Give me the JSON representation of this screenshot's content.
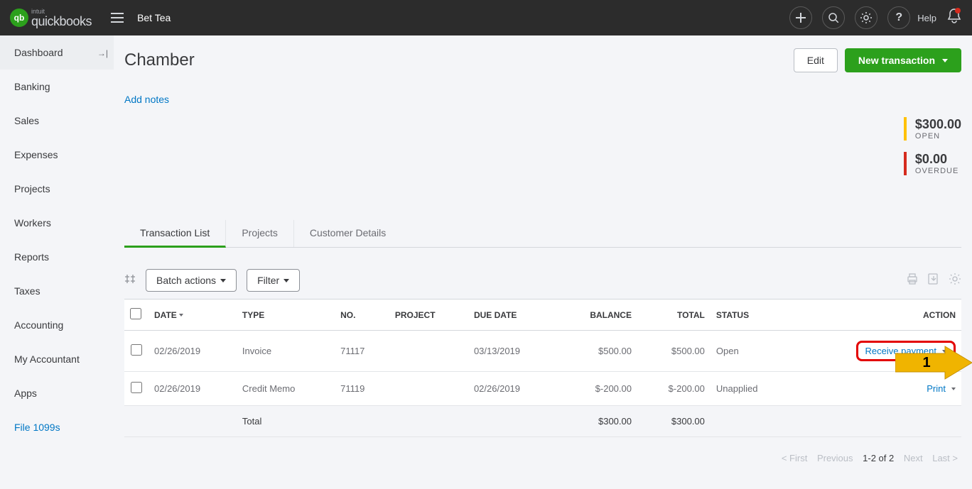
{
  "topbar": {
    "brand_super": "intuit",
    "brand_name": "quickbooks",
    "brand_badge": "qb",
    "company": "Bet Tea",
    "help_label": "Help"
  },
  "sidebar": {
    "items": [
      {
        "label": "Dashboard",
        "active": true
      },
      {
        "label": "Banking"
      },
      {
        "label": "Sales"
      },
      {
        "label": "Expenses"
      },
      {
        "label": "Projects"
      },
      {
        "label": "Workers"
      },
      {
        "label": "Reports"
      },
      {
        "label": "Taxes"
      },
      {
        "label": "Accounting"
      },
      {
        "label": "My Accountant"
      },
      {
        "label": "Apps"
      },
      {
        "label": "File 1099s",
        "blue": true
      }
    ]
  },
  "header": {
    "title": "Chamber",
    "edit": "Edit",
    "new_txn": "New transaction",
    "add_notes": "Add notes"
  },
  "summary": {
    "open": {
      "amount": "$300.00",
      "label": "OPEN"
    },
    "overdue": {
      "amount": "$0.00",
      "label": "OVERDUE"
    }
  },
  "tabs": [
    "Transaction List",
    "Projects",
    "Customer Details"
  ],
  "toolbar": {
    "batch": "Batch actions",
    "filter": "Filter"
  },
  "cols": {
    "date": "DATE",
    "type": "TYPE",
    "no": "NO.",
    "project": "PROJECT",
    "due": "DUE DATE",
    "balance": "BALANCE",
    "total": "TOTAL",
    "status": "STATUS",
    "action": "ACTION"
  },
  "rows": [
    {
      "date": "02/26/2019",
      "type": "Invoice",
      "no": "71117",
      "project": "",
      "due": "03/13/2019",
      "balance": "$500.00",
      "total": "$500.00",
      "status": "Open",
      "action": "Receive payment",
      "highlight": true
    },
    {
      "date": "02/26/2019",
      "type": "Credit Memo",
      "no": "71119",
      "project": "",
      "due": "02/26/2019",
      "balance": "$-200.00",
      "total": "$-200.00",
      "status": "Unapplied",
      "action": "Print"
    }
  ],
  "totals": {
    "label": "Total",
    "balance": "$300.00",
    "total": "$300.00"
  },
  "pager": {
    "first": "< First",
    "prev": "Previous",
    "range": "1-2 of 2",
    "next": "Next",
    "last": "Last >"
  },
  "annotation": {
    "label": "1"
  }
}
